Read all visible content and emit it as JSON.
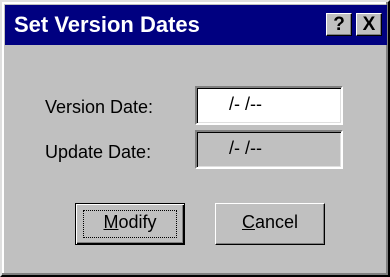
{
  "window": {
    "title": "Set Version Dates",
    "help_button": "?",
    "close_button": "X"
  },
  "fields": {
    "version_date": {
      "label": "Version Date:",
      "value": "/- /--"
    },
    "update_date": {
      "label": "Update Date:",
      "value": "/- /--"
    }
  },
  "buttons": {
    "modify": {
      "mnemonic": "M",
      "rest": "odify"
    },
    "cancel": {
      "mnemonic": "C",
      "rest": "ancel"
    }
  },
  "colors": {
    "titlebar": "#000080",
    "face": "#c0c0c0",
    "input_bg": "#ffffff"
  }
}
